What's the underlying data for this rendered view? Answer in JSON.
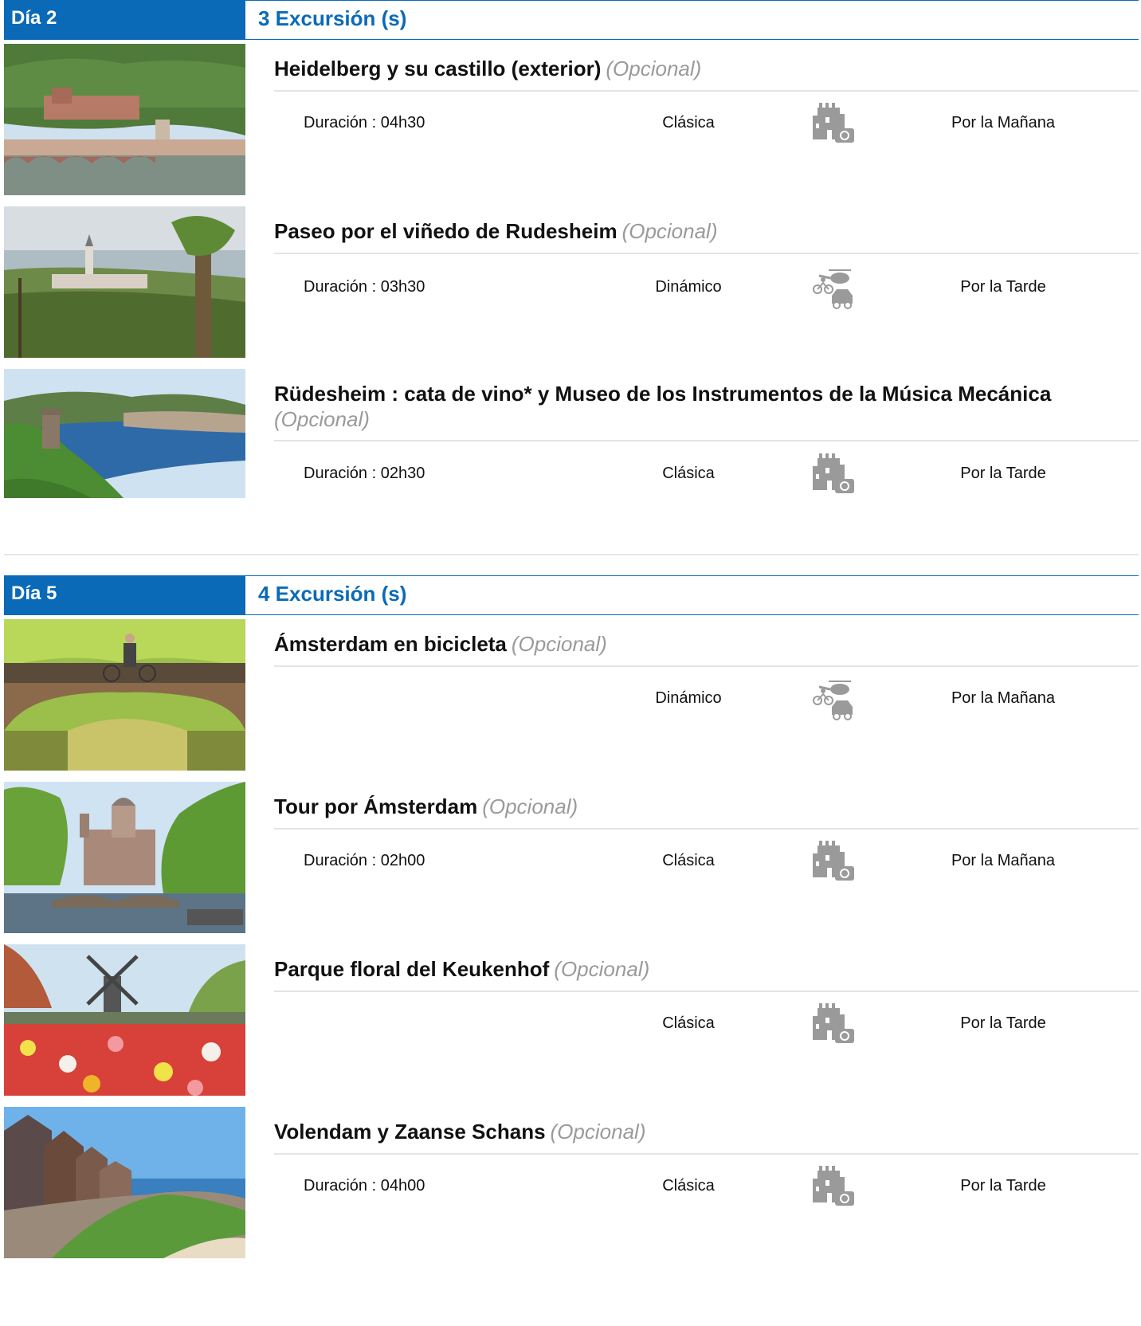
{
  "colors": {
    "accent": "#0a6ab8",
    "optional": "#9a9a9a",
    "rule": "#e4e4e4"
  },
  "days": [
    {
      "label": "Día 2",
      "count_label": "3 Excursión (s)",
      "excursions": [
        {
          "title": "Heidelberg y su castillo (exterior)",
          "optional": "(Opcional)",
          "duration": "Duración : 04h30",
          "type": "Clásica",
          "icon": "castle-camera-icon",
          "time": "Por la Mañana",
          "image": "heidelberg-castle-bridge-photo"
        },
        {
          "title": "Paseo por el viñedo de Rudesheim",
          "optional": "(Opcional)",
          "duration": "Duración : 03h30",
          "type": "Dinámico",
          "icon": "helicopter-bike-car-icon",
          "time": "Por la Tarde",
          "image": "rudesheim-vineyard-photo"
        },
        {
          "title": "Rüdesheim : cata de vino* y Museo de los Instrumentos de la Música Mecánica",
          "optional": "(Opcional)",
          "duration": "Duración : 02h30",
          "type": "Clásica",
          "icon": "castle-camera-icon",
          "time": "Por la Tarde",
          "image": "rhine-river-valley-photo"
        }
      ]
    },
    {
      "label": "Día 5",
      "count_label": "4 Excursión (s)",
      "excursions": [
        {
          "title": "Ámsterdam en bicicleta",
          "optional": "(Opcional)",
          "duration": "",
          "type": "Dinámico",
          "icon": "helicopter-bike-car-icon",
          "time": "Por la Mañana",
          "image": "amsterdam-bridge-cyclist-photo"
        },
        {
          "title": "Tour por Ámsterdam",
          "optional": "(Opcional)",
          "duration": "Duración : 02h00",
          "type": "Clásica",
          "icon": "castle-camera-icon",
          "time": "Por la Mañana",
          "image": "amsterdam-canal-church-photo"
        },
        {
          "title": "Parque floral del Keukenhof",
          "optional": "(Opcional)",
          "duration": "",
          "type": "Clásica",
          "icon": "castle-camera-icon",
          "time": "Por la Tarde",
          "image": "keukenhof-tulips-windmill-photo"
        },
        {
          "title": "Volendam y Zaanse Schans",
          "optional": "(Opcional)",
          "duration": "Duración : 04h00",
          "type": "Clásica",
          "icon": "castle-camera-icon",
          "time": "Por la Tarde",
          "image": "volendam-seaside-houses-photo"
        }
      ]
    }
  ]
}
